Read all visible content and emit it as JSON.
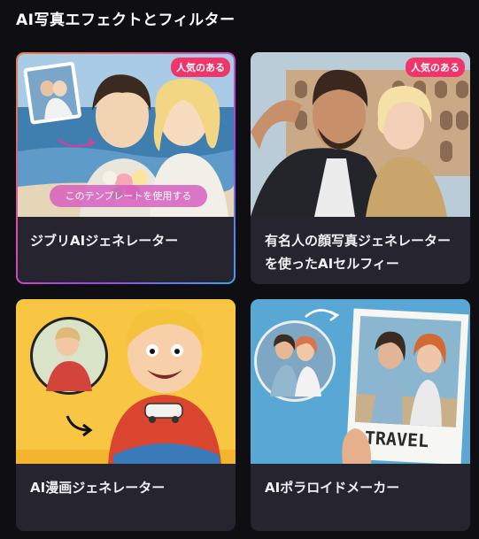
{
  "section": {
    "title": "AI写真エフェクトとフィルター"
  },
  "cards": [
    {
      "title": "ジブリAIジェネレーター",
      "badge": "人気のある",
      "cta": "このテンプレートを使用する"
    },
    {
      "title": "有名人の顔写真ジェネレーターを使ったAIセルフィー",
      "badge": "人気のある"
    },
    {
      "title": "AI漫画ジェネレーター"
    },
    {
      "title": "AIポラロイドメーカー",
      "thumb_text": "TRAVEL"
    }
  ],
  "colors": {
    "background": "#0f0f13",
    "card": "#25242f",
    "badge": "#f0356b",
    "accent_gradient": [
      "#e7833a",
      "#d14ab8",
      "#9a47e6",
      "#38a6e3"
    ]
  }
}
